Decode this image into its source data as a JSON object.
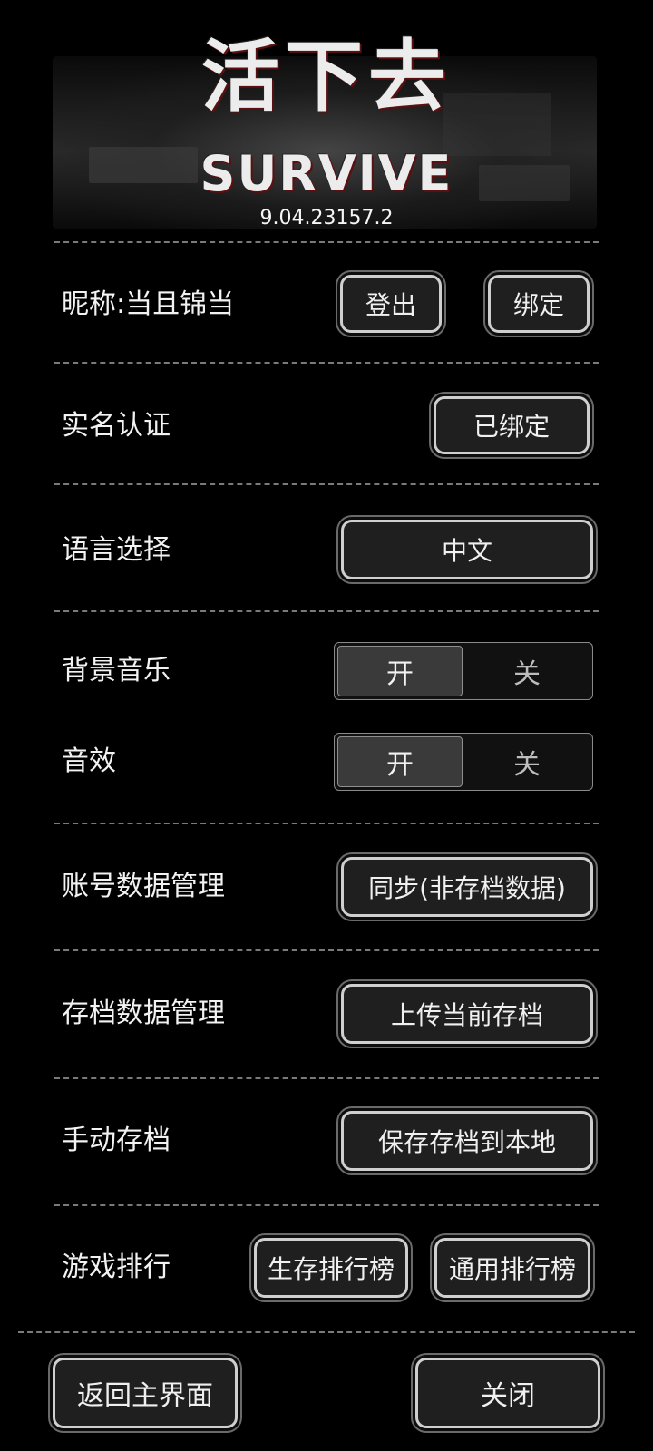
{
  "header": {
    "logo_cn": "活下去",
    "logo_en": "SURVIVE",
    "version": "9.04.23157.2"
  },
  "account": {
    "nickname_label": "昵称:当且锦当",
    "logout_label": "登出",
    "bind_label": "绑定"
  },
  "realname": {
    "label": "实名认证",
    "status_label": "已绑定"
  },
  "language": {
    "label": "语言选择",
    "value": "中文"
  },
  "bgm": {
    "label": "背景音乐",
    "on_label": "开",
    "off_label": "关",
    "state": "on"
  },
  "sfx": {
    "label": "音效",
    "on_label": "开",
    "off_label": "关",
    "state": "on"
  },
  "account_data": {
    "label": "账号数据管理",
    "button_label": "同步(非存档数据)"
  },
  "save_data": {
    "label": "存档数据管理",
    "button_label": "上传当前存档"
  },
  "manual_save": {
    "label": "手动存档",
    "button_label": "保存存档到本地"
  },
  "ranking": {
    "label": "游戏排行",
    "survival_label": "生存排行榜",
    "general_label": "通用排行榜"
  },
  "footer": {
    "back_label": "返回主界面",
    "close_label": "关闭"
  },
  "colors": {
    "background": "#000000",
    "button_fill": "#1f1f1f",
    "button_border": "#cfcfcf",
    "divider": "#7a7a7a",
    "logo_blood": "#5a1010"
  }
}
